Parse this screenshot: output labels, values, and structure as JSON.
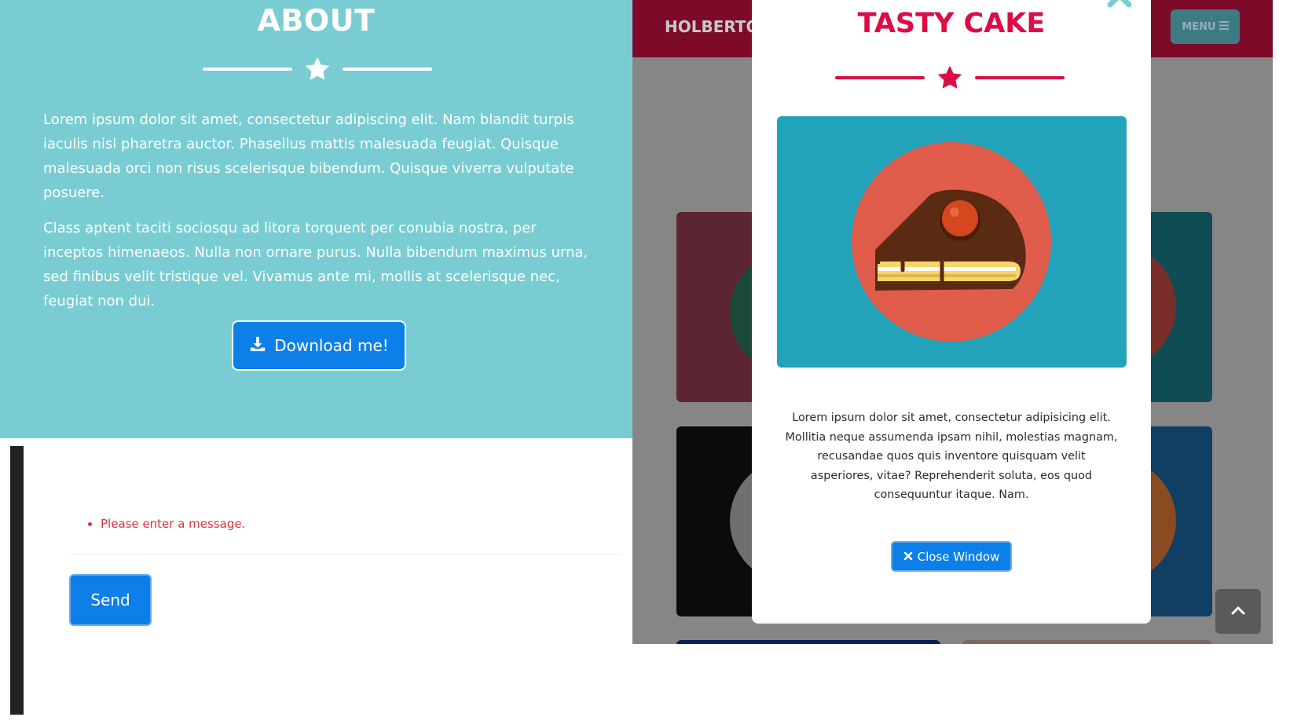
{
  "about": {
    "title": "ABOUT",
    "paragraph1": "Lorem ipsum dolor sit amet, consectetur adipiscing elit. Nam blandit turpis iaculis nisl pharetra auctor. Phasellus mattis malesuada feugiat. Quisque malesuada orci non risus scelerisque bibendum. Quisque viverra vulputate posuere.",
    "paragraph2": "Class aptent taciti sociosqu ad litora torquent per conubia nostra, per inceptos himenaeos. Nulla non ornare purus. Nulla bibendum maximus urna, sed finibus velit tristique vel. Vivamus ante mi, mollis at scelerisque nec, feugiat non dui.",
    "download_label": "Download me!"
  },
  "contact": {
    "error_message": "Please enter a message.",
    "send_label": "Send"
  },
  "navbar": {
    "brand": "HOLBERTO",
    "menu_label": "MENU"
  },
  "modal": {
    "title": "TASTY CAKE",
    "description": "Lorem ipsum dolor sit amet, consectetur adipisicing elit. Mollitia neque assumenda ipsam nihil, molestias magnam, recusandae quos quis inventore quisquam velit asperiores, vitae? Reprehenderit soluta, eos quod consequuntur itaque. Nam.",
    "close_label": "Close Window"
  },
  "icons": {
    "download": "download-icon",
    "star": "star-icon",
    "close": "close-icon",
    "menu": "bars-icon",
    "scroll_top": "chevron-up-icon"
  },
  "colors": {
    "about_bg": "#79cdd2",
    "primary_button": "#0d7fe8",
    "modal_accent": "#dc0d46",
    "error": "#d9343b",
    "navbar": "#7e0a2a"
  }
}
